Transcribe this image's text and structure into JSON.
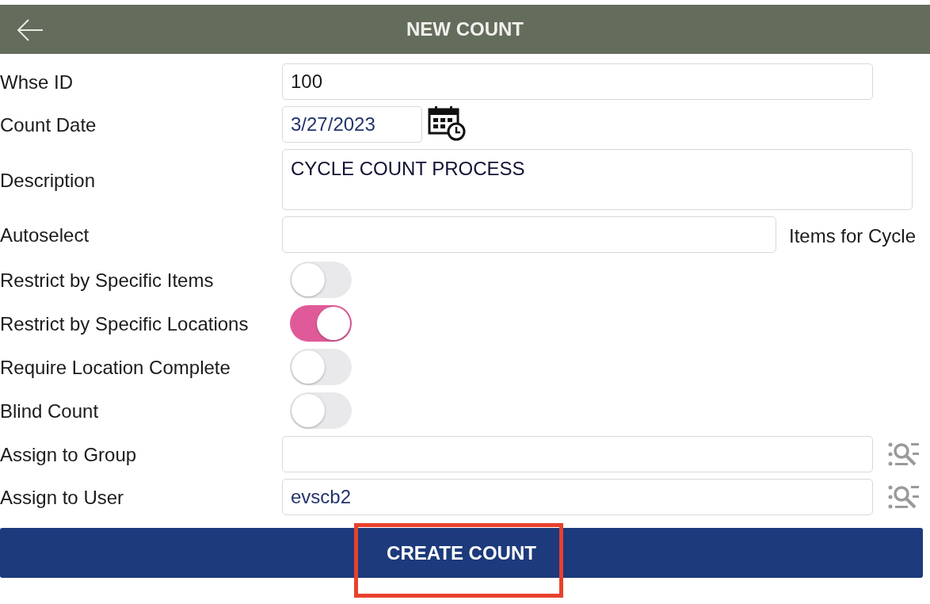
{
  "header": {
    "title": "NEW COUNT"
  },
  "fields": [
    {
      "kind": "text",
      "label": "Whse ID",
      "value": "100"
    },
    {
      "kind": "date",
      "label": "Count Date",
      "value": "3/27/2023"
    },
    {
      "kind": "textarea",
      "label": "Description",
      "value": "CYCLE COUNT PROCESS"
    },
    {
      "kind": "suffix",
      "label": "Autoselect",
      "suffix": "Items for Cycle"
    },
    {
      "kind": "toggle",
      "label": "Restrict by Specific Items",
      "on": false
    },
    {
      "kind": "toggle",
      "label": "Restrict by Specific Locations",
      "on": true
    },
    {
      "kind": "toggle",
      "label": "Require Location Complete",
      "on": false
    },
    {
      "kind": "toggle",
      "label": "Blind Count",
      "on": false
    },
    {
      "kind": "lookup",
      "label": "Assign to Group"
    },
    {
      "kind": "lookup",
      "label": "Assign to User",
      "value": "evscb2"
    }
  ],
  "submit": {
    "label": "CREATE COUNT",
    "highlighted": true
  }
}
